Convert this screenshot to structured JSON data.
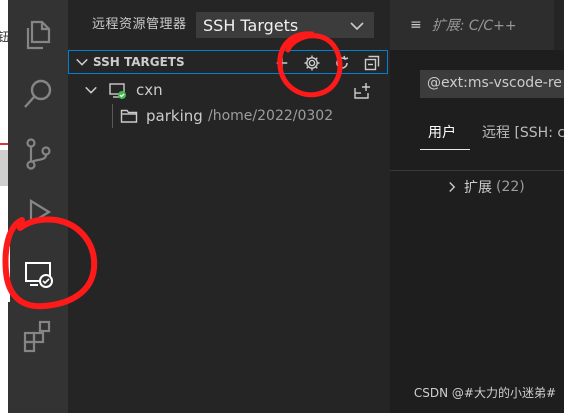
{
  "other_window": {
    "glyph": "钮"
  },
  "activity_bar": {
    "items": [
      {
        "id": "explorer",
        "icon": "files-icon"
      },
      {
        "id": "search",
        "icon": "search-icon"
      },
      {
        "id": "scm",
        "icon": "source-control-icon"
      },
      {
        "id": "run",
        "icon": "run-debug-icon"
      },
      {
        "id": "remote",
        "icon": "remote-explorer-icon",
        "active": true
      },
      {
        "id": "extensions",
        "icon": "extensions-icon"
      }
    ]
  },
  "sidebar": {
    "title": "远程资源管理器",
    "target_select": {
      "value": "SSH Targets"
    },
    "section": {
      "label": "SSH TARGETS",
      "actions": [
        "add-icon",
        "gear-icon",
        "refresh-icon",
        "collapse-all-icon"
      ]
    },
    "tree": [
      {
        "label": "cxn",
        "type": "host",
        "status": "connected",
        "action_icon": "new-window-icon"
      },
      {
        "label": "parking",
        "description": "/home/2022/0302",
        "type": "folder"
      }
    ]
  },
  "editor": {
    "tab": {
      "icon": "≡",
      "label": "扩展: C/C++"
    },
    "search": {
      "value": "@ext:ms-vscode-remote.remote-ssh"
    },
    "tabs": [
      {
        "label": "用户",
        "active": true
      },
      {
        "label": "远程 [SSH: cxn]"
      }
    ],
    "installed": {
      "label": "扩展",
      "count": "(22)"
    }
  },
  "watermark": "CSDN @#大力的小迷弟#",
  "colors": {
    "activity_bar": "#333333",
    "sidebar": "#252526",
    "editor": "#1e1e1e",
    "focus_border": "#007fd4",
    "status_connected": "#3fb950",
    "annotation_red": "#ff1a1a"
  }
}
